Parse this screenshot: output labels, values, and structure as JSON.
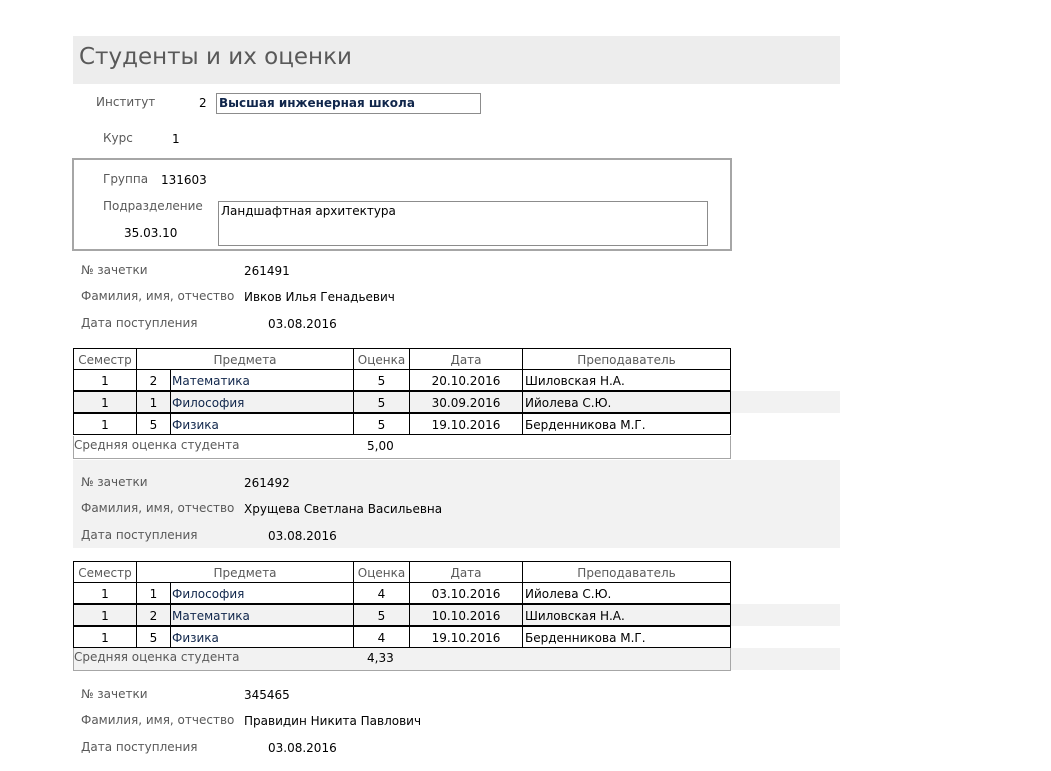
{
  "report": {
    "title": "Студенты и их оценки"
  },
  "header": {
    "institute_label": "Институт",
    "institute_code": "2",
    "institute_name": "Высшая инженерная школа",
    "course_label": "Курс",
    "course_value": "1",
    "group_label": "Группа",
    "group_value": "131603",
    "division_label": "Подразделение",
    "division_code": "35.03.10",
    "division_name": "Ландшафтная архитектура"
  },
  "labels": {
    "record_book": "№ зачетки",
    "full_name": "Фамилия, имя, отчество",
    "admission_date": "Дата поступления",
    "average": "Средняя оценка студента"
  },
  "table_headers": {
    "semester": "Семестр",
    "subject": "Предмета",
    "grade": "Оценка",
    "date": "Дата",
    "teacher": "Преподаватель"
  },
  "students": [
    {
      "record_book": "261491",
      "full_name": "Ивков Илья Генадьевич",
      "admission_date": "03.08.2016",
      "average": "5,00",
      "grades": [
        {
          "semester": "1",
          "num": "2",
          "subject": "Математика",
          "grade": "5",
          "date": "20.10.2016",
          "teacher": "Шиловская Н.А."
        },
        {
          "semester": "1",
          "num": "1",
          "subject": "Философия",
          "grade": "5",
          "date": "30.09.2016",
          "teacher": "Ийолева С.Ю."
        },
        {
          "semester": "1",
          "num": "5",
          "subject": "Физика",
          "grade": "5",
          "date": "19.10.2016",
          "teacher": "Берденникова М.Г."
        }
      ]
    },
    {
      "record_book": "261492",
      "full_name": "Хрущева Светлана Васильевна",
      "admission_date": "03.08.2016",
      "average": "4,33",
      "grades": [
        {
          "semester": "1",
          "num": "1",
          "subject": "Философия",
          "grade": "4",
          "date": "03.10.2016",
          "teacher": "Ийолева С.Ю."
        },
        {
          "semester": "1",
          "num": "2",
          "subject": "Математика",
          "grade": "5",
          "date": "10.10.2016",
          "teacher": "Шиловская Н.А."
        },
        {
          "semester": "1",
          "num": "5",
          "subject": "Физика",
          "grade": "4",
          "date": "19.10.2016",
          "teacher": "Берденникова М.Г."
        }
      ]
    },
    {
      "record_book": "345465",
      "full_name": "Правидин Никита Павлович",
      "admission_date": "03.08.2016"
    }
  ]
}
